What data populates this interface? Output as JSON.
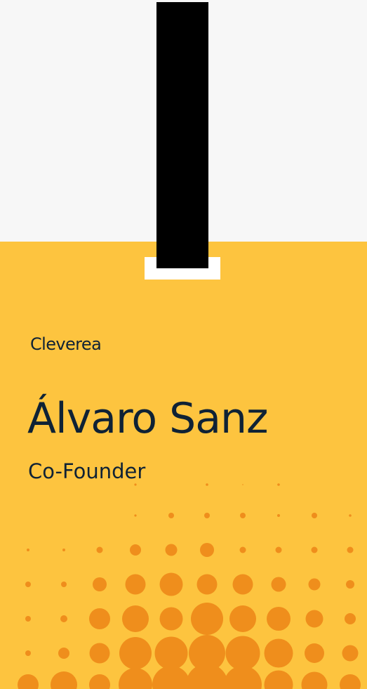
{
  "badge": {
    "logo": "Cleverea",
    "name": "Álvaro Sanz",
    "role": "Co-Founder"
  },
  "colors": {
    "background": "#f7f7f7",
    "badge": "#fdc43f",
    "dots": "#ef8e1c",
    "text": "#0f2235",
    "lanyard": "#000000",
    "clip": "#ffffff"
  }
}
